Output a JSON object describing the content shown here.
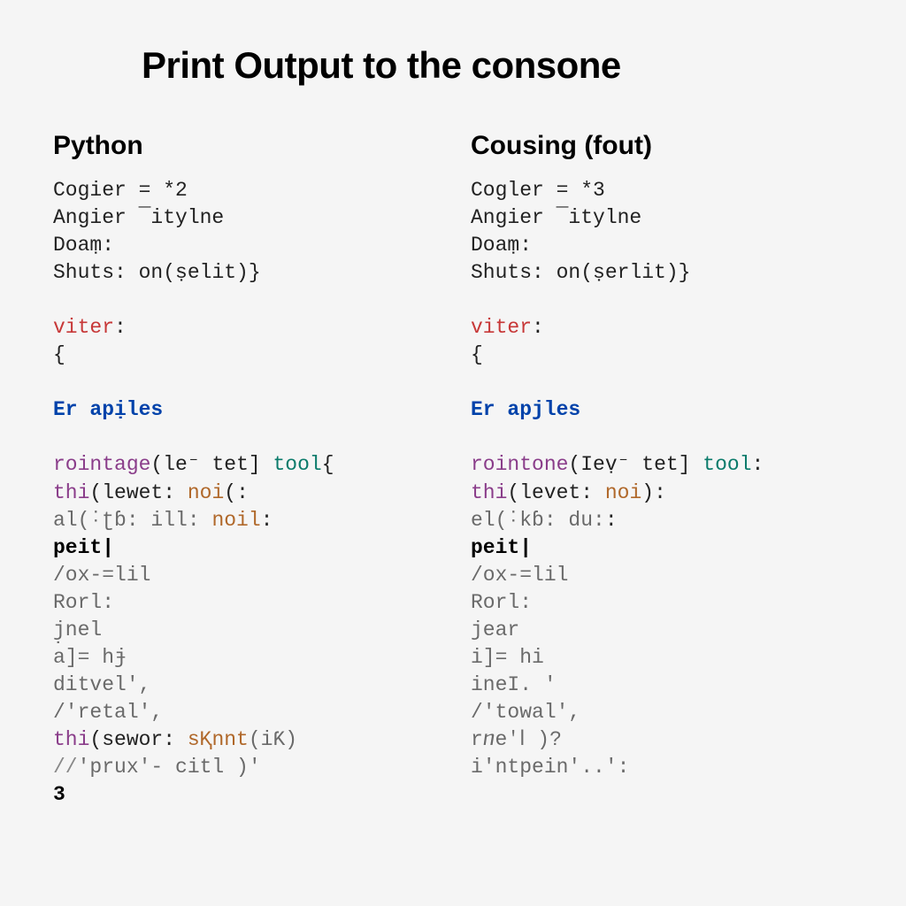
{
  "title": "Print Output to the consone",
  "left": {
    "heading": "Python",
    "l1a": "Cogier = ",
    "l1b": "*2",
    "l2": "Angier ¯itylne",
    "l3": "Doaṃ:",
    "l4a": "Shuts: on",
    "l4b": "(ṣelit)}",
    "l5a": "viter",
    "l5b": ":",
    "l6": "{",
    "l7": "Er apịles",
    "l8a": "rointage",
    "l8b": "(le⁻ tet] ",
    "l8c": "tool",
    "l8d": "{",
    "l9a": "thi",
    "l9b": "(lewet: ",
    "l9c": "noi",
    "l9d": "(:",
    "l10a": "al(",
    "l10b": "˸ʈɓ: ill: ",
    "l10c": "noil",
    "l10d": ":",
    "l11": "peit|",
    "l12": "/ox-=lil",
    "l13": "Rorl:",
    "l14": "j̣nel",
    "l15": "a]= hɉ",
    "l16": "ditvel',",
    "l17": "/'retal',",
    "l18a": "thi",
    "l18b": "(sewor: ",
    "l18c": "sⱩnnt",
    "l18d": "(iƘ)",
    "l19a": "//",
    "l19b": "'prux'- citl )'",
    "l20": "3"
  },
  "right": {
    "heading": "Cousing (fout)",
    "l1a": "Cogler = ",
    "l1b": "*3",
    "l2": "Angier ¯itylne",
    "l3": "Doaṃ:",
    "l4a": "Shuts: on",
    "l4b": "(ṣerlit)}",
    "l5a": "viter",
    "l5b": ":",
    "l6": "{",
    "l7": "Er apjles",
    "l8a": "rointone",
    "l8b": "(Ieṿ⁻ tet] ",
    "l8c": "tool",
    "l8d": ":",
    "l9a": "thi",
    "l9b": "(levet: ",
    "l9c": "noi",
    "l9d": "):",
    "l10a": "el(",
    "l10b": "˸kɓ: du:",
    "l10c": ":",
    "l11": "peit|",
    "l12": "/ox-=lil",
    "l13": "Rorl:",
    "l14": "jear",
    "l15": "i]= hi",
    "l16": "ineI. '",
    "l17": "/'towal',",
    "l18": "rⴖeꞌⅼ )?",
    "l19": "i'ntpein'..':"
  }
}
